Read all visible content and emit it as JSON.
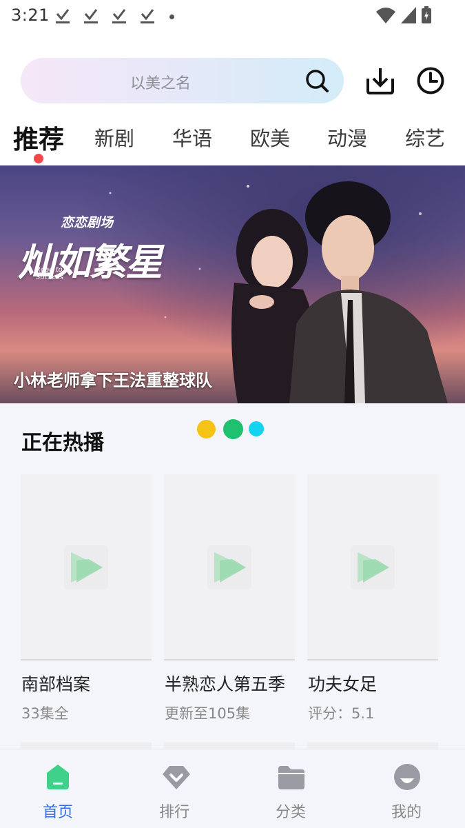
{
  "status_bar": {
    "time": "3:21"
  },
  "search": {
    "placeholder": "以美之名"
  },
  "tabs": [
    {
      "label": "推荐",
      "active": true
    },
    {
      "label": "新剧",
      "active": false
    },
    {
      "label": "华语",
      "active": false
    },
    {
      "label": "欧美",
      "active": false
    },
    {
      "label": "动漫",
      "active": false
    },
    {
      "label": "综艺",
      "active": false
    }
  ],
  "banner": {
    "caption": "小林老师拿下王法重整球队",
    "brand": "恋恋剧场",
    "title": "灿如繁星",
    "subtitle": "Road to Success",
    "carousel_dot_colors": [
      "#f7c216",
      "#1fc06f",
      "#12d4f0"
    ]
  },
  "section": {
    "title": "正在热播"
  },
  "cards": [
    {
      "title": "南部档案",
      "subtitle": "33集全"
    },
    {
      "title": "半熟恋人第五季",
      "subtitle": "更新至105集"
    },
    {
      "title": "功夫女足",
      "subtitle": "评分：5.1"
    }
  ],
  "bottom_nav": [
    {
      "label": "首页",
      "icon": "home-icon",
      "active": true
    },
    {
      "label": "排行",
      "icon": "ranking-icon",
      "active": false
    },
    {
      "label": "分类",
      "icon": "folder-icon",
      "active": false
    },
    {
      "label": "我的",
      "icon": "profile-icon",
      "active": false
    }
  ],
  "colors": {
    "accent": "#2f6ee8",
    "tab_indicator": "#f04a4a",
    "active_nav_icon": "#3fd08a"
  }
}
